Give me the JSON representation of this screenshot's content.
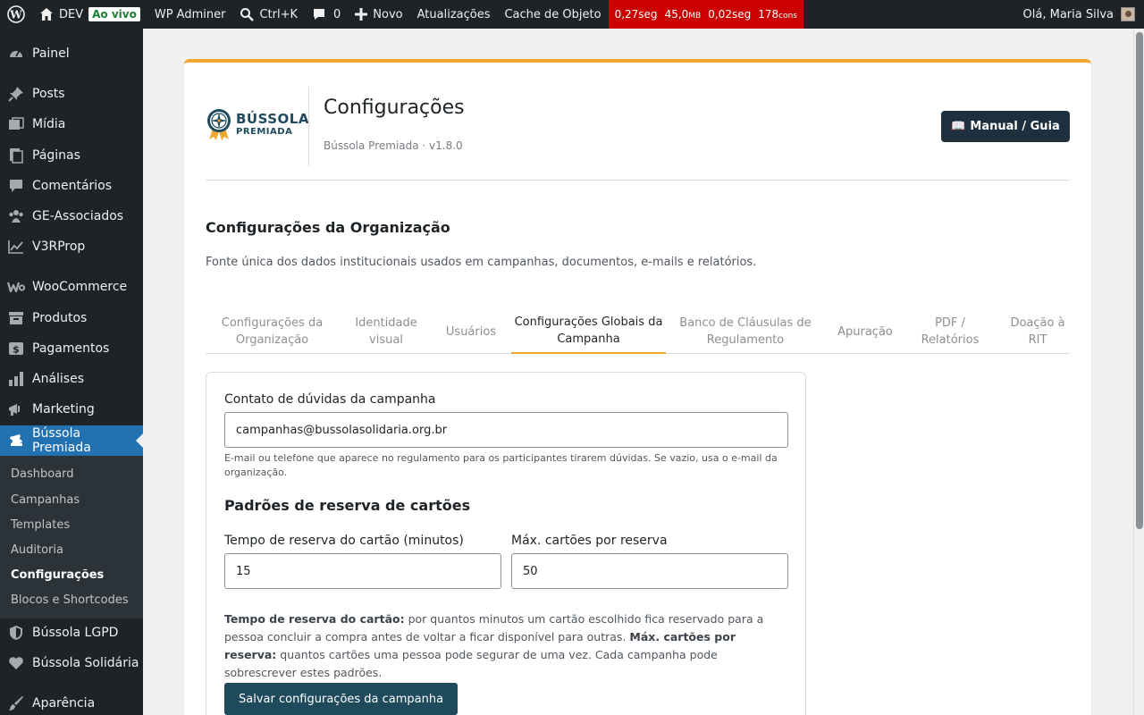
{
  "adminbar": {
    "site_name": "DEV",
    "live_badge": "Ao vivo",
    "adminer": "WP Adminer",
    "shortcut": "Ctrl+K",
    "comments_count": "0",
    "new_label": "Novo",
    "updates": "Atualizações",
    "object_cache": "Cache de Objeto",
    "qm": {
      "time": "0,27seg",
      "memory": "45,0",
      "memory_unit": "MB",
      "db_time": "0,02seg",
      "queries": "178",
      "queries_unit": "cons"
    },
    "greeting": "Olá, Maria Silva"
  },
  "sidebar": {
    "items": [
      {
        "label": "Painel",
        "icon": "dashboard-icon"
      },
      {
        "label": "Posts",
        "icon": "pin-icon"
      },
      {
        "label": "Mídia",
        "icon": "media-icon"
      },
      {
        "label": "Páginas",
        "icon": "pages-icon"
      },
      {
        "label": "Comentários",
        "icon": "comment-icon"
      },
      {
        "label": "GE-Associados",
        "icon": "groups-icon"
      },
      {
        "label": "V3RProp",
        "icon": "chart-line-icon"
      },
      {
        "label": "WooCommerce",
        "icon": "woocommerce-icon"
      },
      {
        "label": "Produtos",
        "icon": "archive-icon"
      },
      {
        "label": "Pagamentos",
        "icon": "dollar-icon"
      },
      {
        "label": "Análises",
        "icon": "bar-chart-icon"
      },
      {
        "label": "Marketing",
        "icon": "megaphone-icon"
      },
      {
        "label": "Bússola Premiada",
        "icon": "tickets-icon"
      },
      {
        "label": "Bússola LGPD",
        "icon": "shield-icon"
      },
      {
        "label": "Bússola Solidária",
        "icon": "heart-icon"
      },
      {
        "label": "Aparência",
        "icon": "brush-icon"
      }
    ],
    "submenu": [
      "Dashboard",
      "Campanhas",
      "Templates",
      "Auditoria",
      "Configurações",
      "Blocos e Shortcodes"
    ]
  },
  "header": {
    "logo_line1": "BÚSSOLA",
    "logo_line2": "PREMIADA",
    "title": "Configurações",
    "subtitle": "Bússola Premiada · v1.8.0",
    "guide_button": "Manual / Guia",
    "guide_icon": "📖"
  },
  "section": {
    "title": "Configurações da Organização",
    "description": "Fonte única dos dados institucionais usados em campanhas, documentos, e-mails e relatórios."
  },
  "tabs": [
    {
      "label": "Configurações da Organização"
    },
    {
      "label": "Identidade visual"
    },
    {
      "label": "Usuários"
    },
    {
      "label": "Configurações Globais da Campanha"
    },
    {
      "label": "Banco de Cláusulas de Regulamento"
    },
    {
      "label": "Apuração"
    },
    {
      "label": "PDF / Relatórios"
    },
    {
      "label": "Doação à RIT"
    }
  ],
  "form": {
    "contact_label": "Contato de dúvidas da campanha",
    "contact_value": "campanhas@bussolasolidaria.org.br",
    "contact_help": "E-mail ou telefone que aparece no regulamento para os participantes tirarem dúvidas. Se vazio, usa o e-mail da organização.",
    "reservation_title": "Padrões de reserva de cartões",
    "reservation_time_label": "Tempo de reserva do cartão (minutos)",
    "reservation_time_value": "15",
    "max_cards_label": "Máx. cartões por reserva",
    "max_cards_value": "50",
    "note_bold1": "Tempo de reserva do cartão:",
    "note_text1": " por quantos minutos um cartão escolhido fica reservado para a pessoa concluir a compra antes de voltar a ficar disponível para outras. ",
    "note_bold2": "Máx. cartões por reserva:",
    "note_text2": " quantos cartões uma pessoa pode segurar de uma vez. Cada campanha pode sobrescrever estes padrões.",
    "save_button": "Salvar configurações da campanha"
  },
  "colors": {
    "accent": "#f0a92e",
    "menu_current": "#2271b1",
    "admin_dark": "#1d2327",
    "qm_red": "#cc0000",
    "primary_button": "#1e4a5c"
  }
}
